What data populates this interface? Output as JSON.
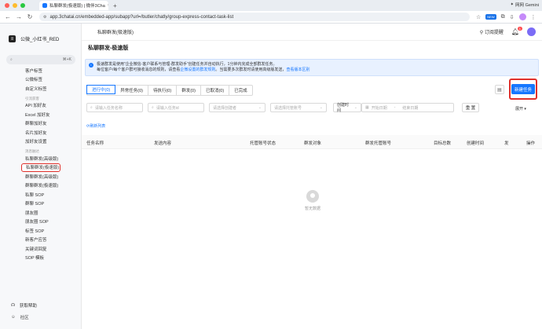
{
  "browser": {
    "tab_title": "私聊群发(极速版) | 微伴3Cha",
    "tab_close": "×",
    "new_tab": "+",
    "url": "app.3chatai.cn/embedded-app/subapp?url=/butler/chatly/group-express-contact-task-list",
    "new_badge": "NEW",
    "profile_label": "网网 Gemini",
    "traffic_colors": [
      "#ff5f57",
      "#febc2e",
      "#28c840"
    ]
  },
  "sidebar": {
    "brand": "公微_小红书_RED",
    "search_placeholder": "",
    "search_kbd": "⌘+K",
    "items": [
      {
        "type": "item",
        "label": "客户标签"
      },
      {
        "type": "item",
        "label": "公微标签"
      },
      {
        "type": "item",
        "label": "自定义标签"
      },
      {
        "type": "group",
        "label": "引流获客"
      },
      {
        "type": "item",
        "label": "API 加好友"
      },
      {
        "type": "item",
        "label": "Excel 加好友"
      },
      {
        "type": "item",
        "label": "群聊加好友"
      },
      {
        "type": "item",
        "label": "名片加好友"
      },
      {
        "type": "item",
        "label": "加好友设置"
      },
      {
        "type": "group",
        "label": "消息触达"
      },
      {
        "type": "item",
        "label": "私聊群发(高级版)"
      },
      {
        "type": "item",
        "label": "私聊群发(极速版)",
        "active": true
      },
      {
        "type": "item",
        "label": "群聊群发(高级版)"
      },
      {
        "type": "item",
        "label": "群聊群发(极速版)"
      },
      {
        "type": "item",
        "label": "私聊 SOP"
      },
      {
        "type": "item",
        "label": "群聊 SOP"
      },
      {
        "type": "item",
        "label": "朋友圈"
      },
      {
        "type": "item",
        "label": "朋友圈 SOP"
      },
      {
        "type": "item",
        "label": "标签 SOP"
      },
      {
        "type": "item",
        "label": "新客户应答"
      },
      {
        "type": "item",
        "label": "关键词回复"
      },
      {
        "type": "item",
        "label": "SOP 模板"
      }
    ],
    "footer": [
      {
        "label": "获取帮助"
      },
      {
        "label": "社区"
      }
    ]
  },
  "header": {
    "breadcrumb": "私聊群发(极速版)",
    "subscribe": "订阅提醒",
    "bell_badge": "1"
  },
  "page": {
    "title": "私聊群发-极速版",
    "notice_line1": "极速群发是使用“企业微信-客户联系与管理-群发助手”创建任务并自动执行，1分钟内完成全部群发任务。",
    "notice_line2_pre": "每位客户/每个客户群可接收消息的规则，请查看",
    "notice_link1": "企微设置的群发规则",
    "notice_line2_mid": "。当需要多次群发时请使用高级版发送，",
    "notice_link2": "查看版本区别",
    "tabs": [
      {
        "label": "进行中(0)",
        "active": true
      },
      {
        "label": "异常任务(0)"
      },
      {
        "label": "待执行(0)"
      },
      {
        "label": "群发(0)"
      },
      {
        "label": "已取消(0)"
      },
      {
        "label": "已完成"
      }
    ],
    "create_button": "新建任务",
    "filters": {
      "task_name": "请输入任务名称",
      "task_id": "请输入任务id",
      "creator": "请选择创建者",
      "hosting": "请选择托管账号",
      "time_type": "创建时间",
      "start_date": "开始日期",
      "end_date": "结束日期",
      "date_sep": "-",
      "reset": "重 置"
    },
    "expand": "展开 ▾",
    "refresh": "⟳刷新列表",
    "columns": [
      "任务名称",
      "发送内容",
      "托管账号状态",
      "群发对象",
      "群发托管账号",
      "目标总数",
      "创建时间",
      "发",
      "操作"
    ],
    "empty_text": "暂无数据"
  }
}
